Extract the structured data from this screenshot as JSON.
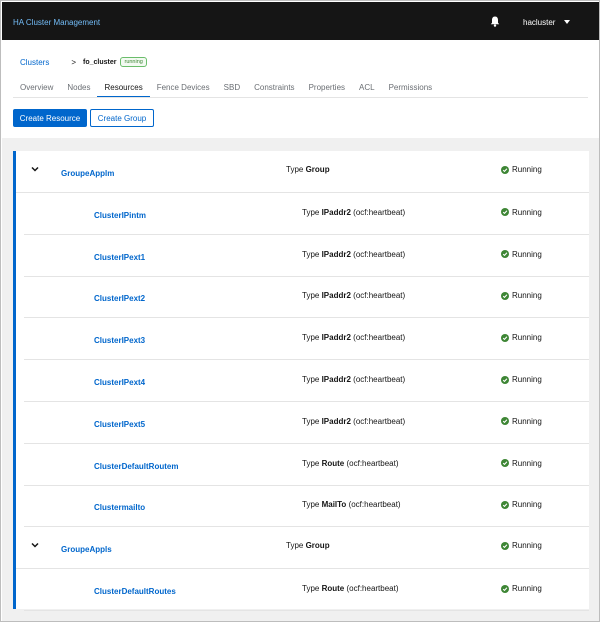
{
  "app": {
    "title": "HA Cluster Management",
    "user": "hacluster"
  },
  "breadcrumb": {
    "root": "Clusters",
    "separator": ">",
    "current": "fo_cluster",
    "badge": "running"
  },
  "tabs": [
    "Overview",
    "Nodes",
    "Resources",
    "Fence Devices",
    "SBD",
    "Constraints",
    "Properties",
    "ACL",
    "Permissions"
  ],
  "active_tab": "Resources",
  "actions": {
    "create_resource": "Create Resource",
    "create_group": "Create Group"
  },
  "type_label": "Type",
  "status_color": "#3e8635",
  "accent_color": "#06c",
  "rows": [
    {
      "kind": "group",
      "name": "GroupeApplm",
      "type": "Group",
      "agent": "",
      "status": "Running"
    },
    {
      "kind": "child",
      "name": "ClusterIPintm",
      "type": "IPaddr2",
      "agent": "(ocf:heartbeat)",
      "status": "Running"
    },
    {
      "kind": "child",
      "name": "ClusterIPext1",
      "type": "IPaddr2",
      "agent": "(ocf:heartbeat)",
      "status": "Running"
    },
    {
      "kind": "child",
      "name": "ClusterIPext2",
      "type": "IPaddr2",
      "agent": "(ocf:heartbeat)",
      "status": "Running"
    },
    {
      "kind": "child",
      "name": "ClusterIPext3",
      "type": "IPaddr2",
      "agent": "(ocf:heartbeat)",
      "status": "Running"
    },
    {
      "kind": "child",
      "name": "ClusterIPext4",
      "type": "IPaddr2",
      "agent": "(ocf:heartbeat)",
      "status": "Running"
    },
    {
      "kind": "child",
      "name": "ClusterIPext5",
      "type": "IPaddr2",
      "agent": "(ocf:heartbeat)",
      "status": "Running"
    },
    {
      "kind": "child",
      "name": "ClusterDefaultRoutem",
      "type": "Route",
      "agent": "(ocf:heartbeat)",
      "status": "Running"
    },
    {
      "kind": "child",
      "name": "Clustermailto",
      "type": "MailTo",
      "agent": "(ocf:heartbeat)",
      "status": "Running"
    },
    {
      "kind": "group",
      "name": "GroupeAppls",
      "type": "Group",
      "agent": "",
      "status": "Running"
    },
    {
      "kind": "child",
      "name": "ClusterDefaultRoutes",
      "type": "Route",
      "agent": "(ocf:heartbeat)",
      "status": "Running"
    }
  ]
}
